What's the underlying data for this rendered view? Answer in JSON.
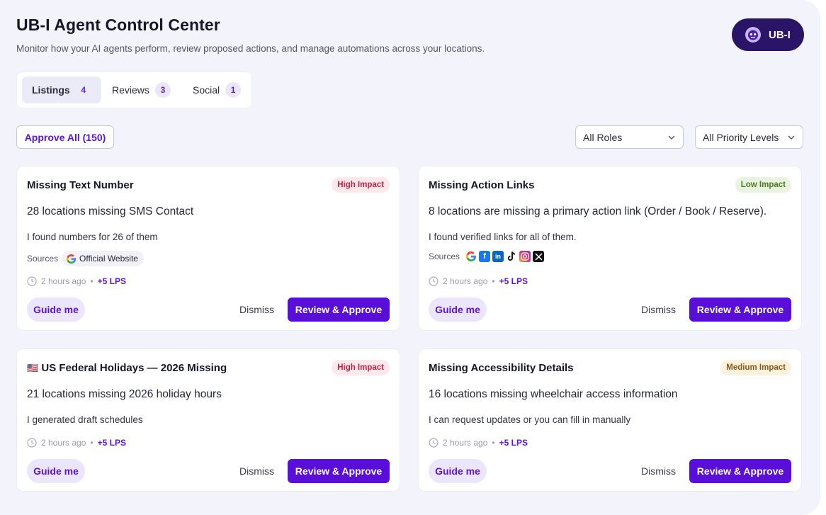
{
  "header": {
    "title": "UB-I Agent Control Center",
    "subtitle": "Monitor how your AI agents perform, review proposed actions, and manage automations across your locations.",
    "brand_label": "UB-I"
  },
  "tabs": [
    {
      "label": "Listings",
      "count": "4",
      "active": true
    },
    {
      "label": "Reviews",
      "count": "3",
      "active": false
    },
    {
      "label": "Social",
      "count": "1",
      "active": false
    }
  ],
  "toolbar": {
    "approve_all_label": "Approve All (150)",
    "role_filter": "All Roles",
    "priority_filter": "All Priority Levels"
  },
  "common": {
    "sources_label": "Sources",
    "guide_label": "Guide me",
    "dismiss_label": "Dismiss",
    "review_label": "Review & Approve"
  },
  "cards": [
    {
      "title": "Missing Text Number",
      "impact": "High Impact",
      "headline": "28 locations missing SMS Contact",
      "description": "I found numbers for 26 of them",
      "source": "Official Website",
      "time": "2 hours ago",
      "lps": "+5 LPS"
    },
    {
      "title": "Missing Action Links",
      "impact": "Low Impact",
      "headline": "8 locations are missing a primary action link (Order / Book / Reserve).",
      "description": "I found verified links for all of them.",
      "source_icons": [
        "google-icon",
        "facebook-icon",
        "linkedin-icon",
        "tiktok-icon",
        "instagram-icon",
        "x-icon"
      ],
      "time": "2 hours ago",
      "lps": "+5 LPS"
    },
    {
      "title": "US Federal Holidays — 2026 Missing",
      "flag": "🇺🇸",
      "impact": "High Impact",
      "headline": "21 locations missing 2026 holiday hours",
      "description": "I generated draft schedules",
      "time": "2 hours ago",
      "lps": "+5 LPS"
    },
    {
      "title": "Missing Accessibility Details",
      "impact": "Medium Impact",
      "headline": "16 locations missing wheelchair access information",
      "description": "I can request updates or you can fill in manually",
      "time": "2 hours ago",
      "lps": "+5 LPS"
    }
  ],
  "colors": {
    "accent": "#5a0fd8",
    "brand_bg": "#2a1468",
    "high": "#c4223f",
    "low": "#4d7a26",
    "medium": "#8a5a14"
  }
}
